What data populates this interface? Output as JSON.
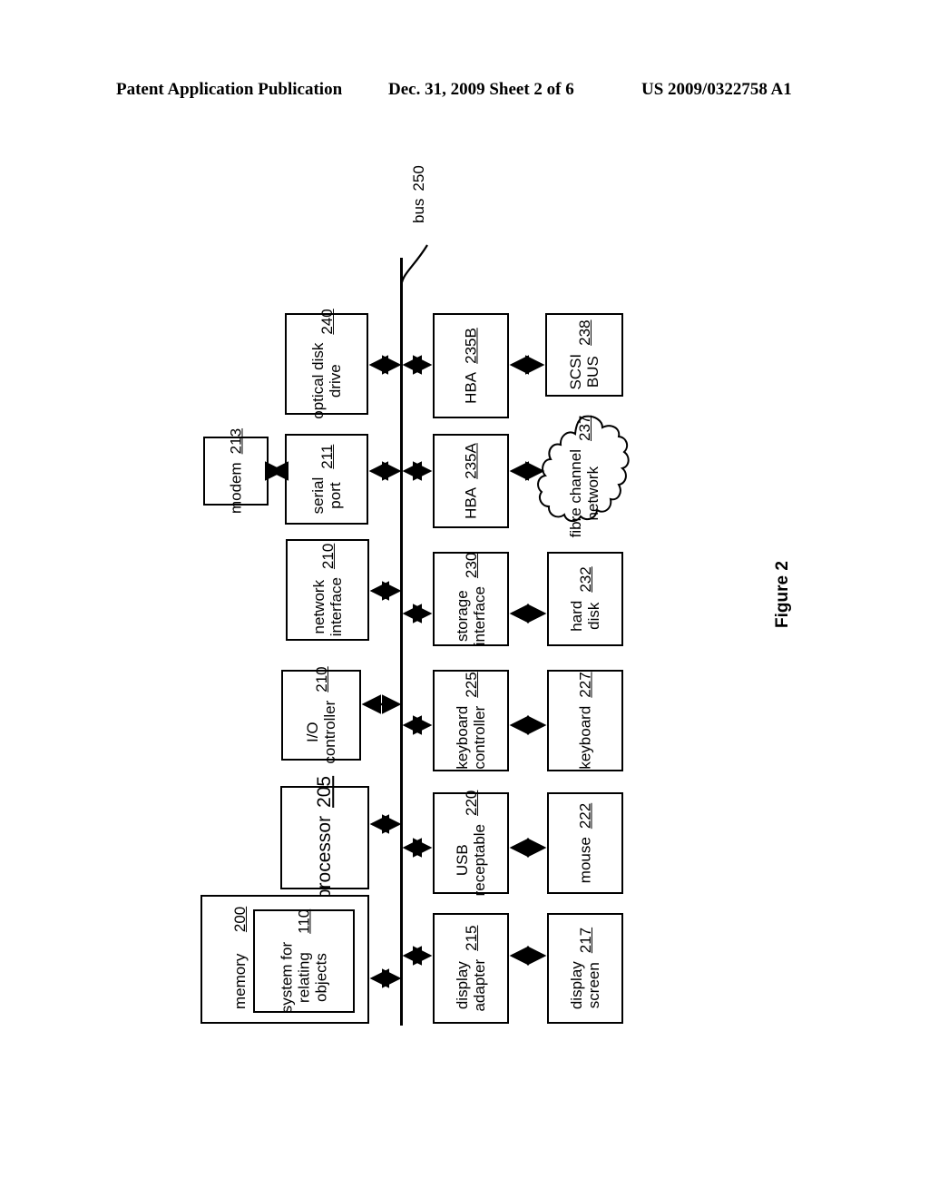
{
  "header": {
    "left": "Patent Application Publication",
    "middle": "Dec. 31, 2009  Sheet 2 of 6",
    "right": "US 2009/0322758 A1"
  },
  "figure": {
    "caption": "Figure 2"
  },
  "bus": {
    "label": "bus",
    "ref": "250"
  },
  "nodes": {
    "memory": {
      "label": "memory",
      "ref": "200"
    },
    "system_relating": {
      "line1": "system for",
      "line2": "relating",
      "line3": "objects",
      "ref": "110"
    },
    "processor": {
      "label": "processor",
      "ref": "205"
    },
    "io_controller": {
      "line1": "I/O",
      "line2": "controller",
      "ref": "210"
    },
    "network_interface": {
      "line1": "network",
      "line2": "interface",
      "ref": "210"
    },
    "serial_port": {
      "line1": "serial",
      "line2": "port",
      "ref": "211"
    },
    "modem": {
      "label": "modem",
      "ref": "213"
    },
    "optical_disk_drive": {
      "line1": "optical disk",
      "line2": "drive",
      "ref": "240"
    },
    "display_adapter": {
      "line1": "display",
      "line2": "adapter",
      "ref": "215"
    },
    "display_screen": {
      "line1": "display",
      "line2": "screen",
      "ref": "217"
    },
    "usb_receptable": {
      "line1": "USB",
      "line2": "receptable",
      "ref": "220"
    },
    "mouse": {
      "label": "mouse",
      "ref": "222"
    },
    "keyboard_controller": {
      "line1": "keyboard",
      "line2": "controller",
      "ref": "225"
    },
    "keyboard": {
      "label": "keyboard",
      "ref": "227"
    },
    "storage_interface": {
      "line1": "storage",
      "line2": "interface",
      "ref": "230"
    },
    "hard_disk": {
      "line1": "hard",
      "line2": "disk",
      "ref": "232"
    },
    "hba_a": {
      "label": "HBA",
      "ref": "235A"
    },
    "fibre_channel_network": {
      "line1": "fibre channel",
      "line2": "network",
      "ref": "237"
    },
    "hba_b": {
      "label": "HBA",
      "ref": "235B"
    },
    "scsi_bus": {
      "line1": "SCSI",
      "line2": "BUS",
      "ref": "238"
    }
  }
}
